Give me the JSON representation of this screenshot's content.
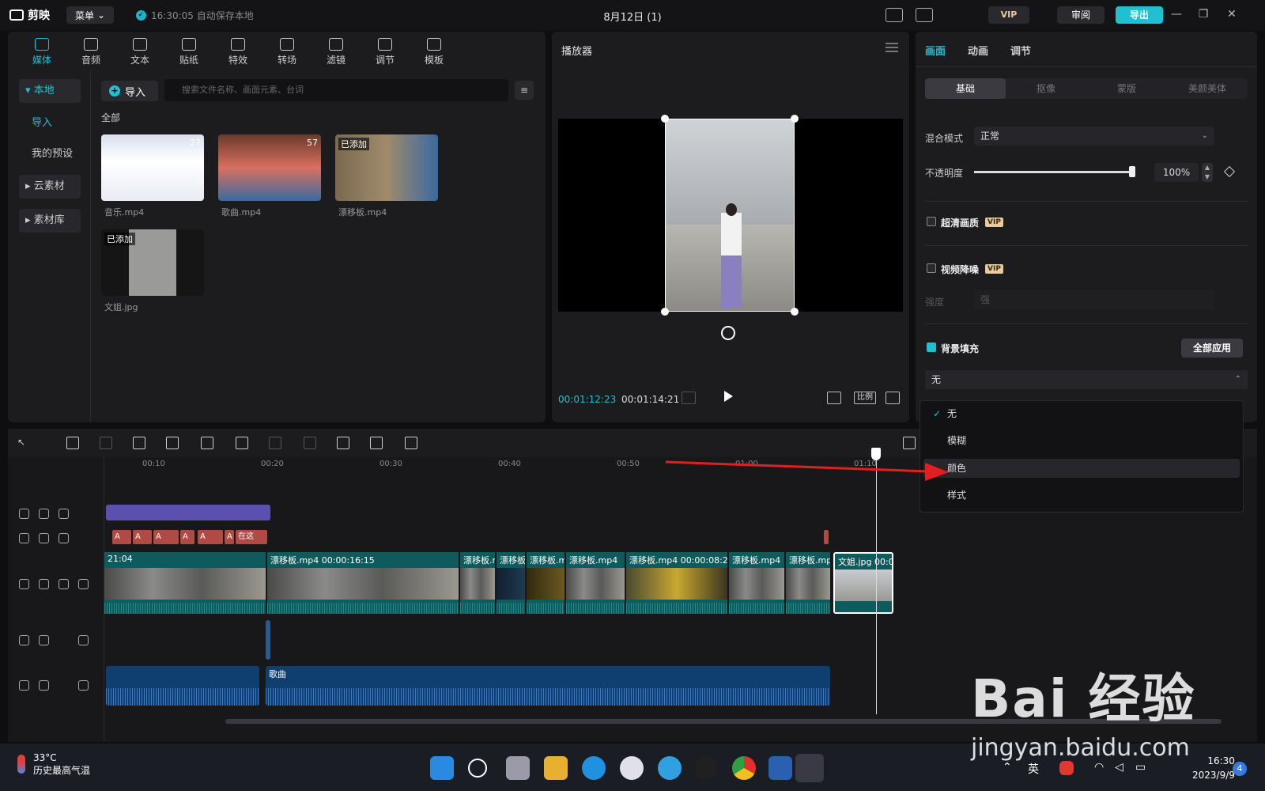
{
  "app": {
    "name": "剪映",
    "menu_label": "菜单",
    "save_status": "16:30:05 自动保存本地",
    "doc_title": "8月12日 (1)",
    "vip_label": "VIP",
    "review_label": "审阅",
    "export_label": "导出"
  },
  "media_tabs": [
    {
      "label": "媒体"
    },
    {
      "label": "音频"
    },
    {
      "label": "文本"
    },
    {
      "label": "贴纸"
    },
    {
      "label": "特效"
    },
    {
      "label": "转场"
    },
    {
      "label": "滤镜"
    },
    {
      "label": "调节"
    },
    {
      "label": "模板"
    }
  ],
  "sidebar": {
    "local": "本地",
    "import": "导入",
    "presets": "我的预设",
    "cloud": "云素材",
    "library": "素材库"
  },
  "media": {
    "import_btn": "导入",
    "search_placeholder": "搜索文件名称、画面元素、台词",
    "all_label": "全部",
    "items": [
      {
        "name": "音乐.mp4",
        "badge": "",
        "duration": "27"
      },
      {
        "name": "歌曲.mp4",
        "badge": "",
        "duration": "57"
      },
      {
        "name": "漂移板.mp4",
        "badge": "已添加",
        "duration": ""
      },
      {
        "name": "文姐.jpg",
        "badge": "已添加",
        "duration": ""
      }
    ]
  },
  "player": {
    "title": "播放器",
    "time_current": "00:01:12:23",
    "time_total": "00:01:14:21",
    "ratio_label": "比例"
  },
  "inspector": {
    "tabs": [
      "画面",
      "动画",
      "调节"
    ],
    "subtabs": [
      "基础",
      "抠像",
      "蒙版",
      "美颜美体"
    ],
    "blend_label": "混合模式",
    "blend_value": "正常",
    "opacity_label": "不透明度",
    "opacity_value": "100%",
    "opacity_level": 1.0,
    "hd_label": "超清画质",
    "denoise_label": "视频降噪",
    "strength_label": "强度",
    "strength_value": "强",
    "bgfill_label": "背景填充",
    "apply_all": "全部应用",
    "bgfill_value": "无",
    "vip_tag": "VIP"
  },
  "dropdown": {
    "items": [
      "无",
      "模糊",
      "颜色",
      "样式"
    ],
    "selected": "无",
    "highlighted": "颜色"
  },
  "timeline": {
    "ruler": [
      "00:10",
      "00:20",
      "00:30",
      "00:40",
      "00:50",
      "01:00",
      "01:10"
    ],
    "text_clips": [
      "A",
      "A",
      "A",
      "A",
      "A",
      "A",
      "A",
      "在这"
    ],
    "video_clips": [
      {
        "label": "21:04"
      },
      {
        "label": "漂移板.mp4  00:00:16:15"
      },
      {
        "label": "漂移板.r"
      },
      {
        "label": "漂移板"
      },
      {
        "label": "漂移板.m"
      },
      {
        "label": "漂移板.mp4"
      },
      {
        "label": "漂移板.mp4  00:00:08:2"
      },
      {
        "label": "漂移板.mp4"
      },
      {
        "label": "漂移板.mp"
      },
      {
        "label": "文姐.jpg  00:0"
      }
    ],
    "audio_label": "歌曲"
  },
  "taskbar": {
    "temp": "33°C",
    "weather": "历史最高气温",
    "lang": "英",
    "time": "16:30",
    "date": "2023/9/9",
    "notifications": "4"
  },
  "watermark": {
    "brand": "Bai 经验",
    "url": "jingyan.baidu.com"
  },
  "colors": {
    "accent": "#20c0d0",
    "arrow": "#e02020",
    "video_track": "#0f5a5c",
    "audio_track": "#0f3e70",
    "text_clip": "#b04a45",
    "fx_clip": "#5b4fb0"
  }
}
